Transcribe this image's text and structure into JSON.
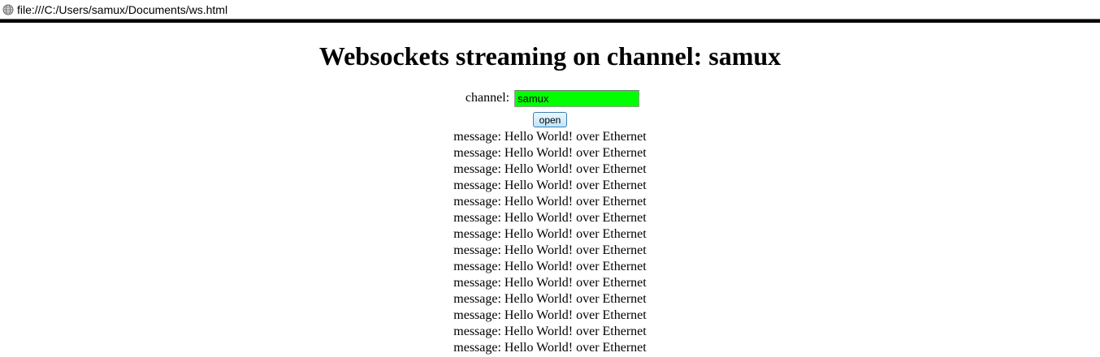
{
  "browser": {
    "url": "file:///C:/Users/samux/Documents/ws.html",
    "url_icon": "globe-icon"
  },
  "page": {
    "title": "Websockets streaming on channel: samux",
    "channel_label": "channel:",
    "channel_value": "samux",
    "channel_input_color": "#00ff00",
    "open_label": "open",
    "messages": [
      "message: Hello World! over Ethernet",
      "message: Hello World! over Ethernet",
      "message: Hello World! over Ethernet",
      "message: Hello World! over Ethernet",
      "message: Hello World! over Ethernet",
      "message: Hello World! over Ethernet",
      "message: Hello World! over Ethernet",
      "message: Hello World! over Ethernet",
      "message: Hello World! over Ethernet",
      "message: Hello World! over Ethernet",
      "message: Hello World! over Ethernet",
      "message: Hello World! over Ethernet",
      "message: Hello World! over Ethernet",
      "message: Hello World! over Ethernet"
    ]
  }
}
